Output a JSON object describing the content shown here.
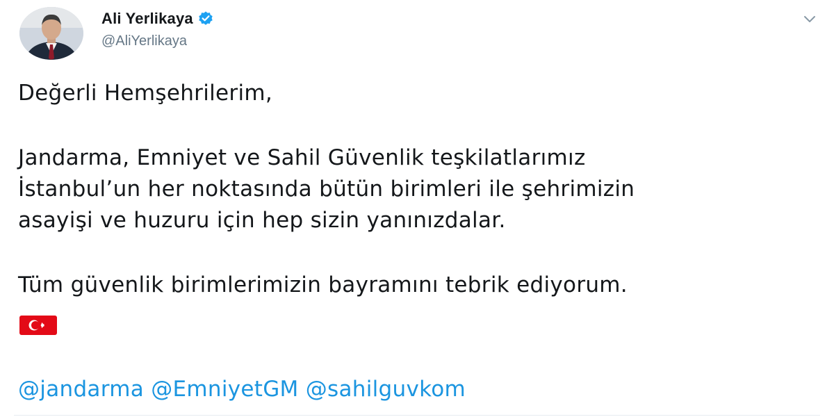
{
  "author": {
    "display_name": "Ali Yerlikaya",
    "handle": "@AliYerlikaya",
    "verified": true
  },
  "tweet": {
    "lines": [
      "Değerli Hemşehrilerim,",
      "Jandarma, Emniyet ve Sahil Güvenlik teşkilatlarımız",
      "İstanbul’un her noktasında bütün birimleri ile şehrimizin",
      "asayişi ve huzuru için hep sizin yanınızdalar.",
      "Tüm güvenlik birimlerimizin bayramını tebrik ediyorum."
    ],
    "emoji": "turkey-flag-icon",
    "mentions": [
      "@jandarma",
      "@EmniyetGM",
      "@sahilguvkom"
    ]
  },
  "colors": {
    "text": "#14171a",
    "secondary": "#657786",
    "link": "#1b95e0",
    "verified_badge": "#1da1f2",
    "flag_red": "#e30a17"
  },
  "icons": {
    "verified": "verified-badge-icon",
    "menu": "chevron-down-icon"
  }
}
